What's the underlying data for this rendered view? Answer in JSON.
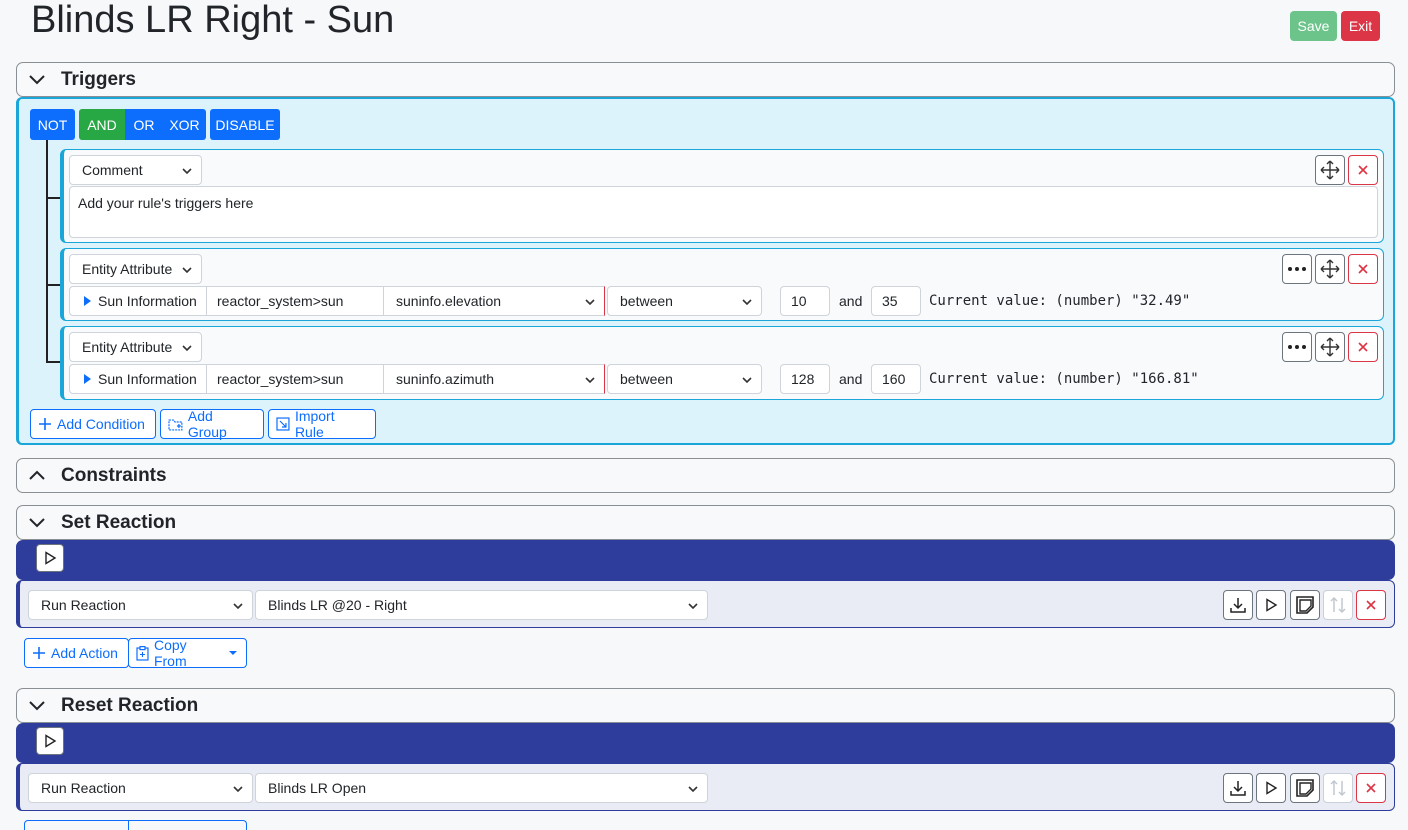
{
  "page": {
    "title": "Blinds LR Right - Sun"
  },
  "header": {
    "save_label": "Save",
    "exit_label": "Exit"
  },
  "colors": {
    "save": "#6cc48a",
    "exit": "#dc3545",
    "primary": "#0d6efd",
    "and_active": "#28a745",
    "trigger_border": "#1aa6d8",
    "reaction_bar": "#2e3c9b"
  },
  "sections": {
    "triggers": "Triggers",
    "constraints": "Constraints",
    "set_reaction": "Set Reaction",
    "reset_reaction": "Reset Reaction"
  },
  "operators": {
    "not": "NOT",
    "and": "AND",
    "or": "OR",
    "xor": "XOR",
    "disable": "DISABLE",
    "active": "AND"
  },
  "conditions": [
    {
      "type": "Comment",
      "text": "Add your rule's triggers here"
    },
    {
      "type": "Entity Attribute",
      "entity_label": "Sun Information",
      "entity_id": "reactor_system>sun",
      "attribute": "suninfo.elevation",
      "operator": "between",
      "value1": "10",
      "and_label": "and",
      "value2": "35",
      "current": "Current value: (number) \"32.49\""
    },
    {
      "type": "Entity Attribute",
      "entity_label": "Sun Information",
      "entity_id": "reactor_system>sun",
      "attribute": "suninfo.azimuth",
      "operator": "between",
      "value1": "128",
      "and_label": "and",
      "value2": "160",
      "current": "Current value: (number) \"166.81\""
    }
  ],
  "trigger_actions": {
    "add_condition": "Add Condition",
    "add_group": "Add Group",
    "import_rule": "Import Rule"
  },
  "set_reaction": {
    "action_type": "Run Reaction",
    "target": "Blinds LR @20 - Right"
  },
  "reset_reaction": {
    "action_type": "Run Reaction",
    "target": "Blinds LR Open"
  },
  "reaction_buttons": {
    "add_action": "Add Action",
    "copy_from": "Copy From"
  }
}
